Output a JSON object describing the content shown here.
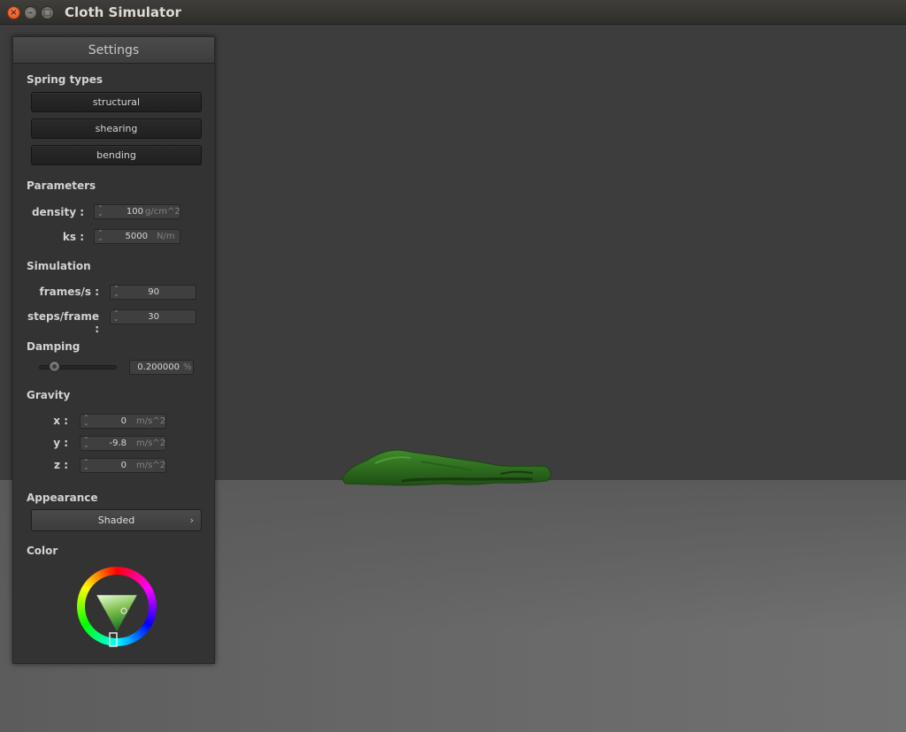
{
  "window": {
    "title": "Cloth Simulator"
  },
  "panel": {
    "title": "Settings",
    "spring_types": {
      "heading": "Spring types",
      "buttons": [
        "structural",
        "shearing",
        "bending"
      ]
    },
    "parameters": {
      "heading": "Parameters",
      "density": {
        "label": "density :",
        "value": "100",
        "unit": "g/cm^2"
      },
      "ks": {
        "label": "ks :",
        "value": "5000",
        "unit": "N/m"
      }
    },
    "simulation": {
      "heading": "Simulation",
      "fps": {
        "label": "frames/s :",
        "value": "90"
      },
      "steps": {
        "label": "steps/frame :",
        "value": "30"
      }
    },
    "damping": {
      "heading": "Damping",
      "value": "0.200000",
      "unit": "%",
      "slider_fraction": 0.2
    },
    "gravity": {
      "heading": "Gravity",
      "x": {
        "label": "x :",
        "value": "0",
        "unit": "m/s^2"
      },
      "y": {
        "label": "y :",
        "value": "-9.8",
        "unit": "m/s^2"
      },
      "z": {
        "label": "z :",
        "value": "0",
        "unit": "m/s^2"
      }
    },
    "appearance": {
      "heading": "Appearance",
      "selected": "Shaded",
      "chevron": "›"
    },
    "color": {
      "heading": "Color",
      "selected_hex": "#1f7a1f"
    }
  },
  "icons": {
    "close": "×",
    "minimize": "–",
    "maximize": "□",
    "spin": "⌃⌄"
  },
  "colors": {
    "cloth": "#2f6e1f",
    "floor": "#666666",
    "backdrop": "#3d3d3d"
  }
}
